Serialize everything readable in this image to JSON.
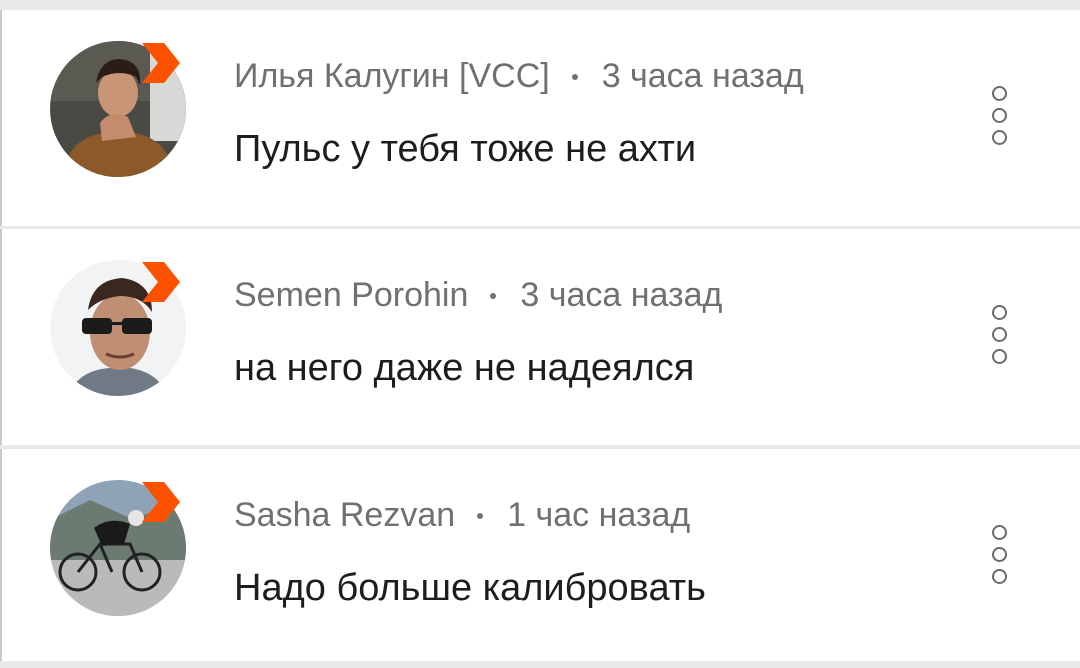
{
  "comments": [
    {
      "author": "Илья Калугин [VCC]",
      "time": "3 часа назад",
      "text": "Пульс у тебя тоже не ахти"
    },
    {
      "author": "Semen Porohin",
      "time": "3 часа назад",
      "text": "на него даже не надеялся"
    },
    {
      "author": "Sasha Rezvan",
      "time": "1 час назад",
      "text": "Надо больше калибровать"
    }
  ],
  "colors": {
    "badge": "#fc5200",
    "author": "#707070",
    "text": "#1d1d1d"
  },
  "icons": {
    "badge": "strava-chevron-icon",
    "more": "more-vertical-icon"
  }
}
